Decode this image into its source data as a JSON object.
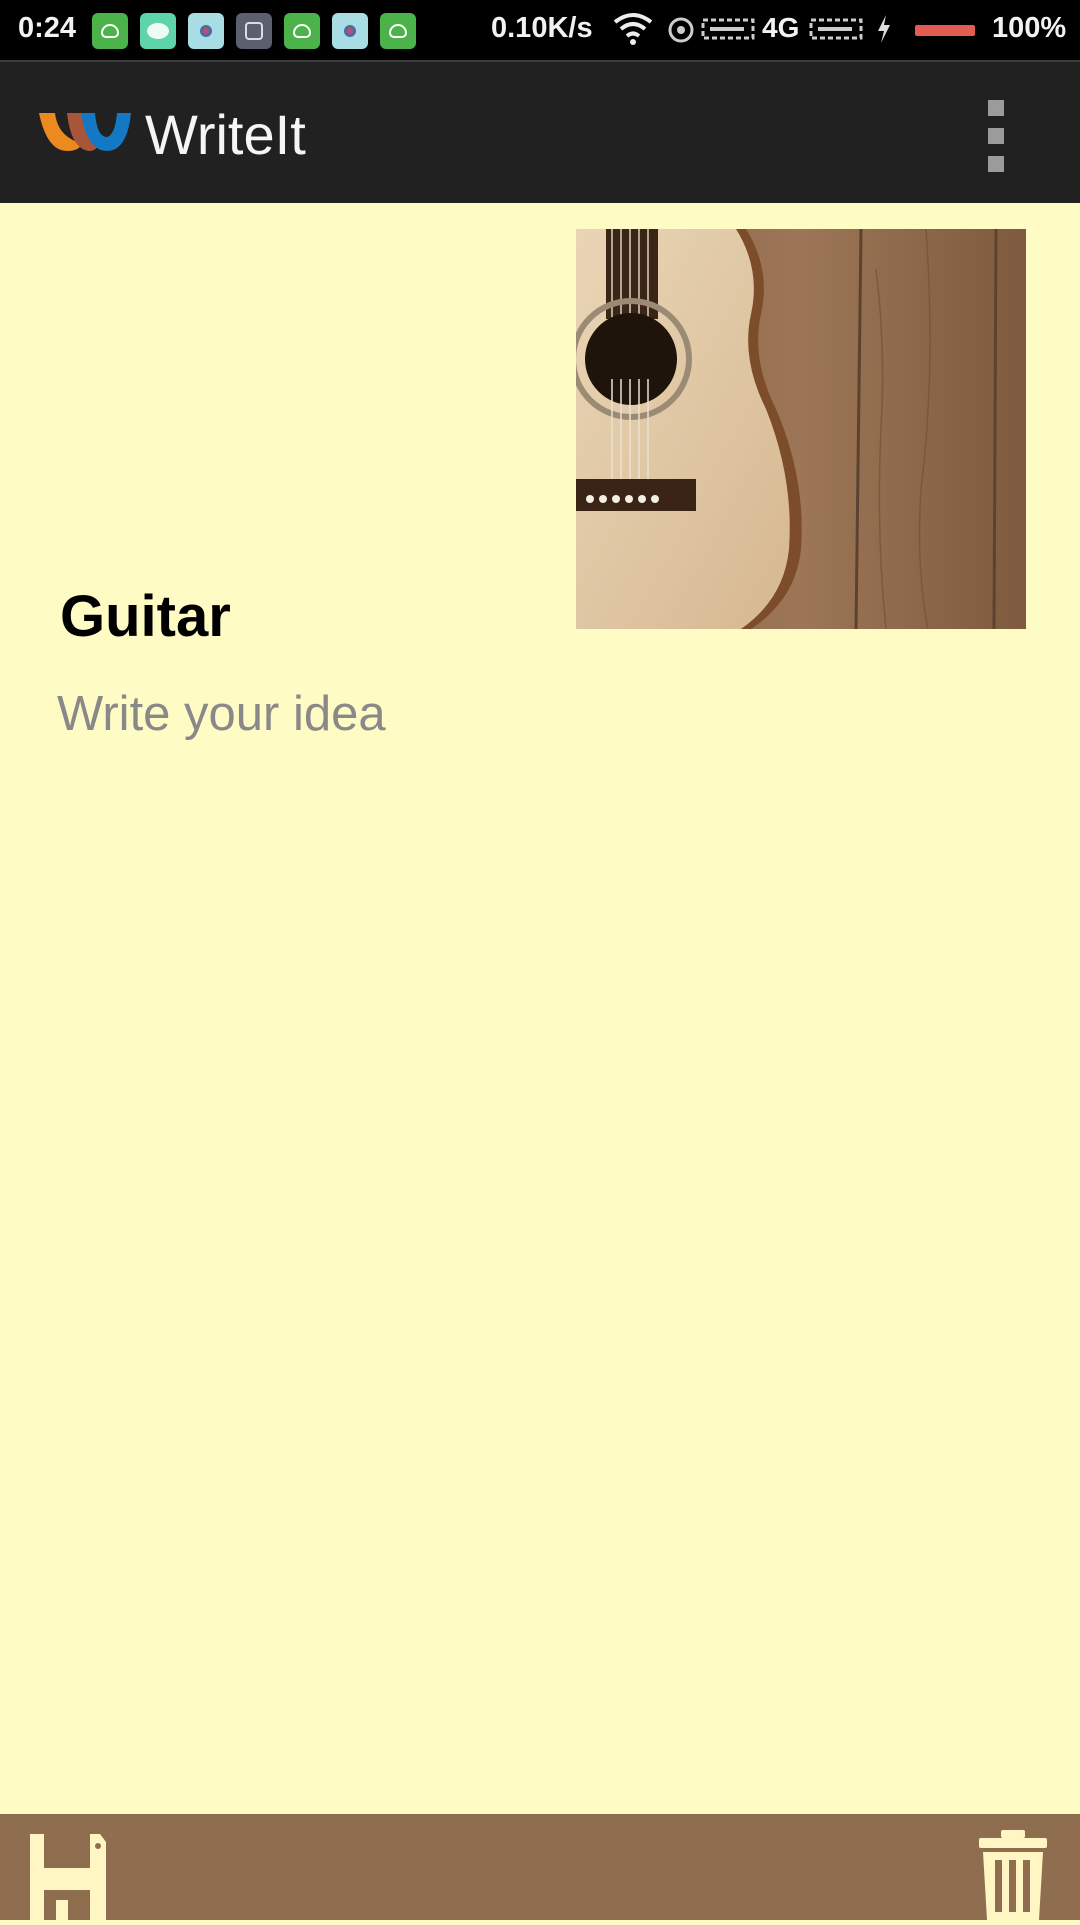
{
  "status_bar": {
    "time": "0:24",
    "net_speed": "0.10K/s",
    "network_type": "4G",
    "battery": "100%",
    "battery_color": "#e35c52",
    "notification_icons": [
      "android-icon",
      "wechat-icon",
      "pinwheel-icon",
      "app-icon",
      "android-icon",
      "pinwheel-icon",
      "android-icon"
    ]
  },
  "app_bar": {
    "title": "WriteIt",
    "menu_icon": "more-vert-icon"
  },
  "note": {
    "title": "Guitar",
    "body_placeholder": "Write your idea",
    "image": "acoustic-guitar-photo"
  },
  "bottom_bar": {
    "save_icon": "save-icon",
    "delete_icon": "trash-icon"
  },
  "colors": {
    "note_background": "#fffbc4",
    "app_bar": "#212121",
    "bottom_bar": "#8f6e4f",
    "logo_orange": "#ec8a1f",
    "logo_blue": "#1479c4"
  }
}
